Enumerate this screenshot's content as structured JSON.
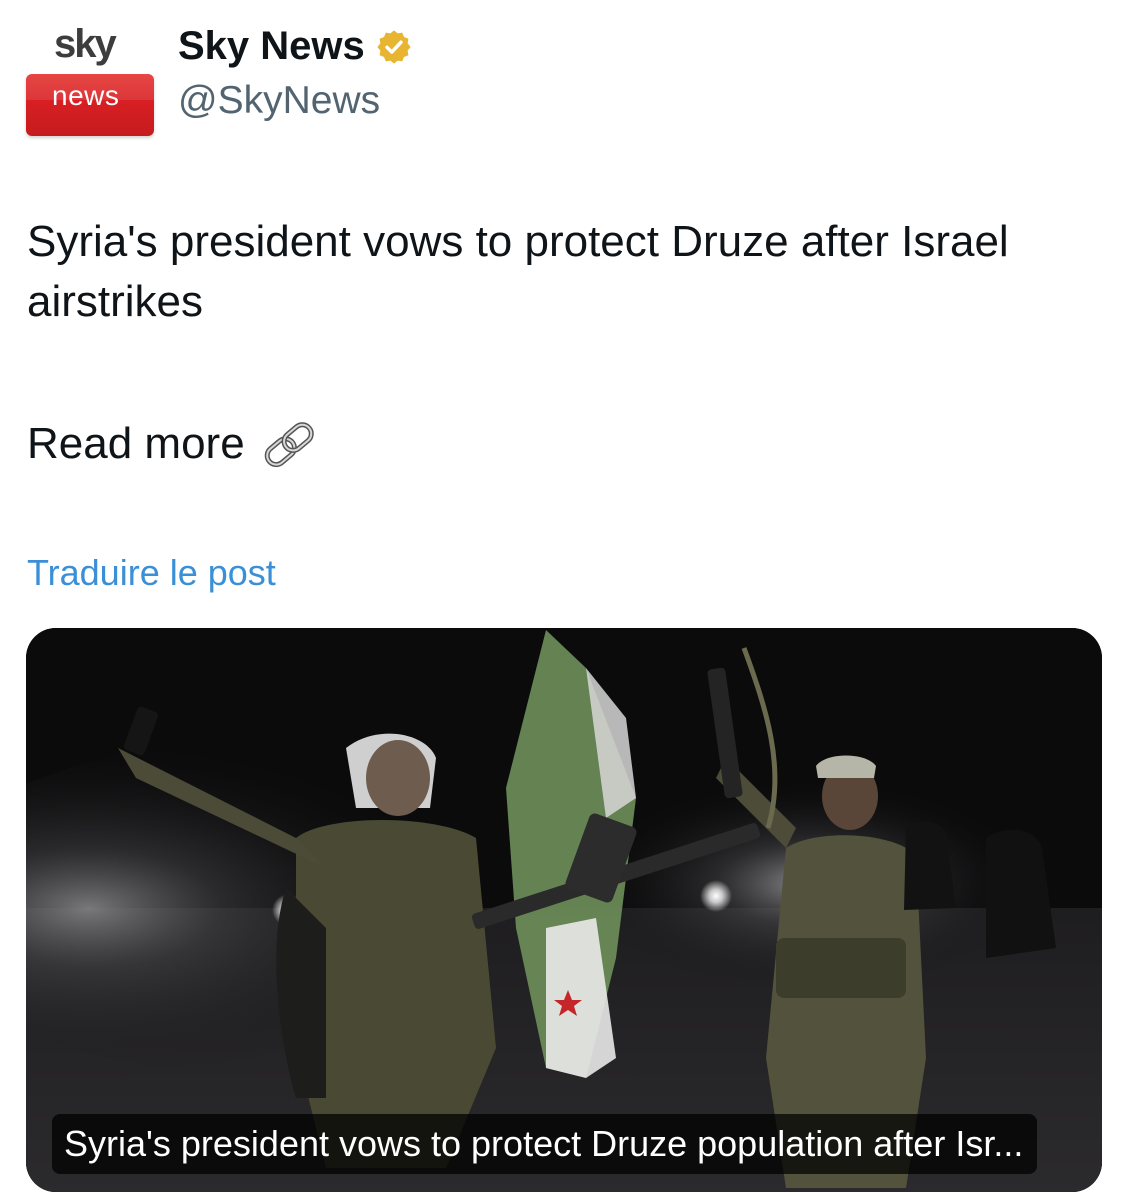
{
  "account": {
    "logo_top": "sky",
    "logo_bottom": "news",
    "display_name": "Sky News",
    "handle": "@SkyNews"
  },
  "post": {
    "text": "Syria's president vows to protect Druze after Israel airstrikes",
    "read_more": "Read more",
    "translate_label": "Traduire le post"
  },
  "card": {
    "caption": "Syria's president vows to protect Druze population after Isr..."
  },
  "icons": {
    "verified": "verified-badge-icon",
    "link": "link-chain-icon"
  },
  "colors": {
    "link": "#3b8fd6",
    "verified_gold": "#e8b530",
    "brand_red": "#d81f23",
    "text": "#0f1419",
    "secondary": "#536471"
  }
}
